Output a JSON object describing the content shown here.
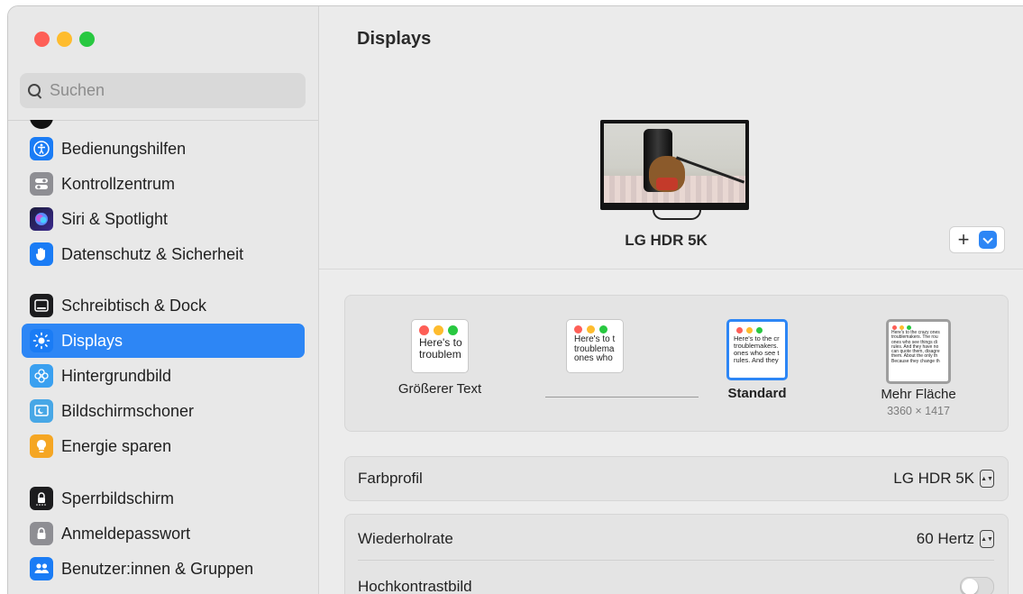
{
  "sidebar": {
    "search": {
      "placeholder": "Suchen",
      "value": ""
    },
    "items": [
      {
        "label": "Bedienungshilfen",
        "icon": "accessibility-icon",
        "color": "#1a7cf5"
      },
      {
        "label": "Kontrollzentrum",
        "icon": "control-center-icon",
        "color": "#8e8e93"
      },
      {
        "label": "Siri & Spotlight",
        "icon": "siri-icon",
        "color": "#3b2a8f"
      },
      {
        "label": "Datenschutz & Sicherheit",
        "icon": "hand-icon",
        "color": "#1a7cf5"
      },
      {
        "label": "Schreibtisch & Dock",
        "icon": "dock-icon",
        "color": "#1c1c1e"
      },
      {
        "label": "Displays",
        "icon": "sun-icon",
        "color": "#1a7cf5",
        "active": true
      },
      {
        "label": "Hintergrundbild",
        "icon": "wallpaper-icon",
        "color": "#3aa0f0"
      },
      {
        "label": "Bildschirmschoner",
        "icon": "screensaver-icon",
        "color": "#47a7e6"
      },
      {
        "label": "Energie sparen",
        "icon": "battery-icon",
        "color": "#f5a623"
      },
      {
        "label": "Sperrbildschirm",
        "icon": "lock-screen-icon",
        "color": "#1c1c1e"
      },
      {
        "label": "Anmeldepasswort",
        "icon": "lock-icon",
        "color": "#8e8e93"
      },
      {
        "label": "Benutzer:innen & Gruppen",
        "icon": "users-icon",
        "color": "#1a7cf5"
      }
    ]
  },
  "main": {
    "title": "Displays",
    "display_name": "LG HDR 5K",
    "add_button": "+",
    "resolution": {
      "options": [
        {
          "label": "Größerer Text",
          "sample": "Here's to\ntroublem",
          "selected": false
        },
        {
          "label": "",
          "sample": "Here's to t\ntroublema\nones who",
          "selected": false
        },
        {
          "label": "Standard",
          "sample": "Here's to the cr\ntroublemakers.\nones who see t\nrules. And they",
          "selected": true
        },
        {
          "label": "Mehr Fläche",
          "sublabel": "3360 × 1417",
          "sample": "Here's to the crazy ones\ntroublemakers. The rou\nones who see things di\nrules. And they have no\ncan quote them, disagre\nthem. About the only th\nBecause they change th",
          "selected": false
        }
      ]
    },
    "settings": {
      "farbprofil": {
        "label": "Farbprofil",
        "value": "LG HDR 5K"
      },
      "wiederholrate": {
        "label": "Wiederholrate",
        "value": "60 Hertz"
      },
      "hochkontrast": {
        "label": "Hochkontrastbild",
        "value": false
      }
    }
  }
}
